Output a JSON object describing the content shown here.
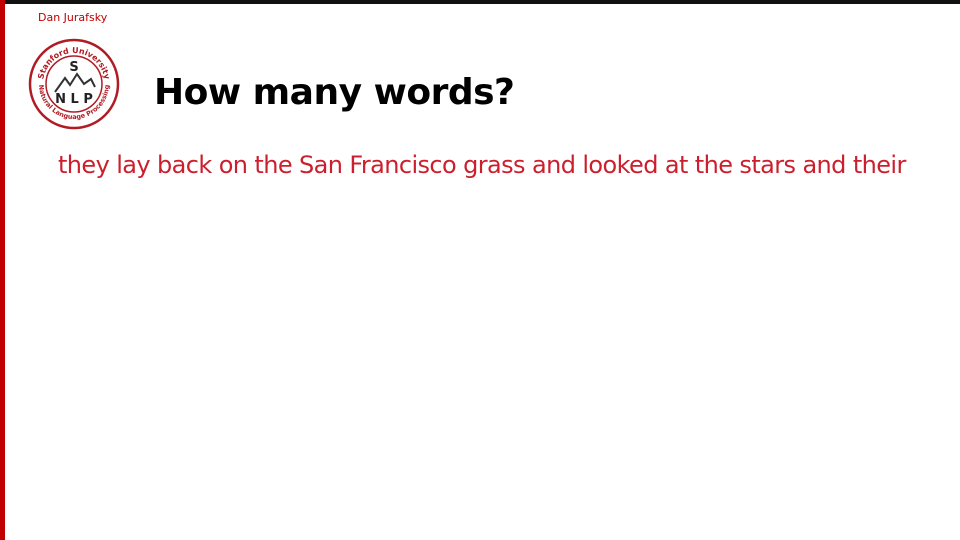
{
  "slide": {
    "author": "Dan Jurafsky",
    "title": "How many words?",
    "sentence": "they lay back on the San Francisco grass and looked at the stars and their"
  },
  "logo": {
    "top_arc_text": "Stanford University",
    "bottom_arc_text": "Natural Language Processing",
    "letter_s": "S",
    "letters_nlp": "N L P"
  },
  "colors": {
    "accent_red": "#c00000",
    "sentence_red": "#cc1f2e",
    "title": "#000000",
    "top_border": "#111111"
  }
}
